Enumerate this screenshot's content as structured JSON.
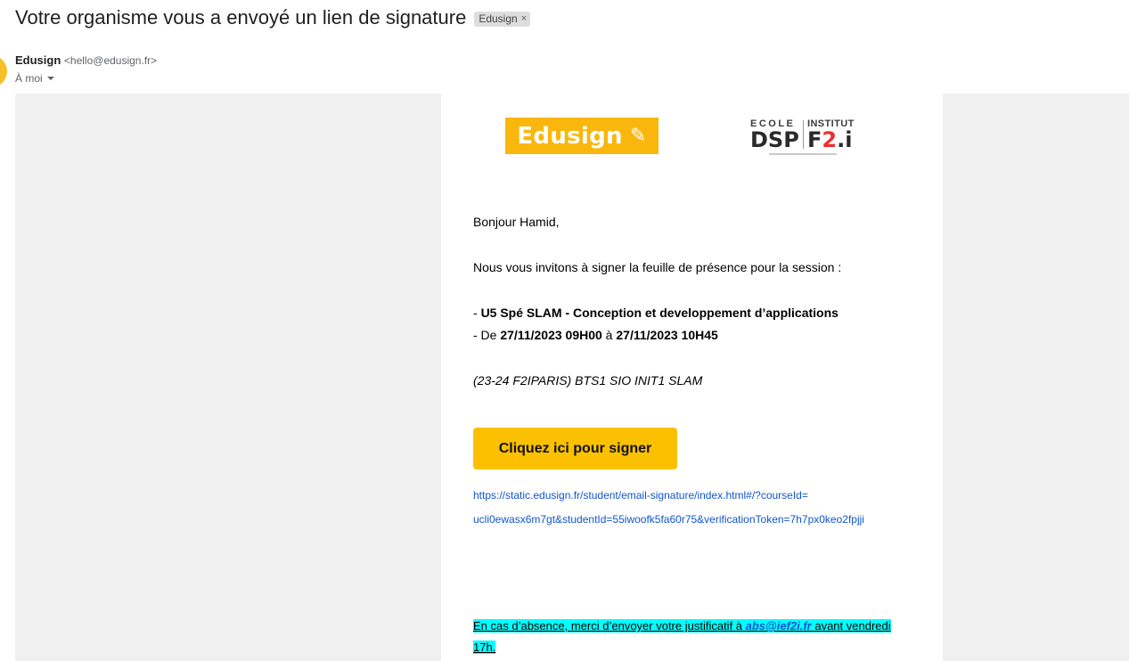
{
  "email": {
    "subject": "Votre organisme vous a envoyé un lien de signature",
    "label": "Edusign",
    "label_close": "×",
    "sender_name": "Edusign",
    "sender_email": "<hello@edusign.fr>",
    "recipient": "À moi"
  },
  "logos": {
    "edusign_text": "Edusign",
    "edusign_icon": "feather-icon",
    "school_top_left": "ECOLE",
    "school_top_right": "INSTITUT",
    "school_left": "DSP",
    "school_right_a": "F",
    "school_right_b": "2",
    "school_right_c": ".i"
  },
  "body": {
    "greeting": "Bonjour Hamid,",
    "invite": "Nous vous invitons à signer la feuille de présence pour la session :",
    "course_prefix": "- ",
    "course_name": "U5 Spé SLAM - Conception et developpement d’applications",
    "date_prefix": "- De ",
    "date_start": "27/11/2023 09H00",
    "date_mid": " à ",
    "date_end": "27/11/2023 10H45",
    "group": "(23-24 F2IPARIS) BTS1 SIO INIT1 SLAM",
    "sign_button": "Cliquez ici pour signer",
    "link_line1": "https://static.edusign.fr/student/email-signature/index.html#/?courseId=",
    "link_line2": "ucli0ewasx6m7gt&studentId=55iwoofk5fa60r75&verificationToken=7h7px0keo2fpjji",
    "absence_before": "En cas d’absence, merci d’envoyer votre justificatif à ",
    "absence_email": "abs@ief2i.fr",
    "absence_after": " avant vendredi 17h."
  },
  "colors": {
    "brand_yellow": "#f9b70d",
    "button_yellow": "#fbc100",
    "link_blue": "#1155cc",
    "highlight_cyan": "#00ffff"
  }
}
